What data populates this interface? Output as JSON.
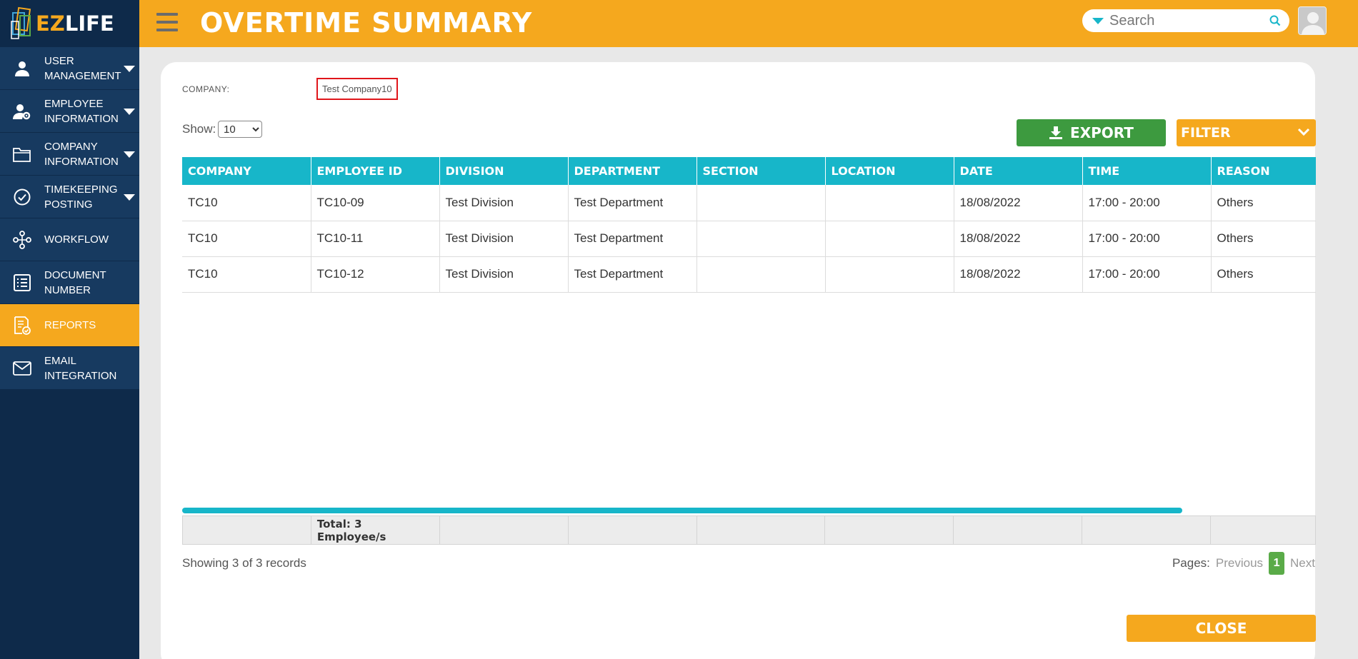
{
  "app": {
    "logo_ez": "EZ",
    "logo_life": "LIFE"
  },
  "sidebar": {
    "items": [
      {
        "line1": "USER",
        "line2": "MANAGEMENT",
        "icon": "user-icon",
        "caret": true
      },
      {
        "line1": "EMPLOYEE",
        "line2": "INFORMATION",
        "icon": "user-gear-icon",
        "caret": true
      },
      {
        "line1": "COMPANY",
        "line2": "INFORMATION",
        "icon": "folder-icon",
        "caret": true
      },
      {
        "line1": "TIMEKEEPING",
        "line2": "POSTING",
        "icon": "check-circle-icon",
        "caret": true
      },
      {
        "line1": "WORKFLOW",
        "line2": "",
        "icon": "workflow-icon",
        "caret": false
      },
      {
        "line1": "DOCUMENT",
        "line2": "NUMBER",
        "icon": "list-icon",
        "caret": false
      },
      {
        "line1": "REPORTS",
        "line2": "",
        "icon": "report-icon",
        "caret": false,
        "active": true
      },
      {
        "line1": "EMAIL",
        "line2": "INTEGRATION",
        "icon": "mail-icon",
        "caret": false
      }
    ]
  },
  "header": {
    "title": "OVERTIME SUMMARY",
    "search_placeholder": "Search"
  },
  "filters": {
    "company_label": "COMPANY:",
    "company_value": "Test Company10",
    "show_label": "Show:",
    "show_value": "10"
  },
  "actions": {
    "export_label": "EXPORT",
    "filter_label": "FILTER",
    "close_label": "CLOSE"
  },
  "table": {
    "columns": [
      "COMPANY",
      "EMPLOYEE ID",
      "DIVISION",
      "DEPARTMENT",
      "SECTION",
      "LOCATION",
      "DATE",
      "TIME",
      "REASON"
    ],
    "rows": [
      [
        "TC10",
        "TC10-09",
        "Test Division",
        "Test Department",
        "",
        "",
        "18/08/2022",
        "17:00 - 20:00",
        "Others"
      ],
      [
        "TC10",
        "TC10-11",
        "Test Division",
        "Test Department",
        "",
        "",
        "18/08/2022",
        "17:00 - 20:00",
        "Others"
      ],
      [
        "TC10",
        "TC10-12",
        "Test Division",
        "Test Department",
        "",
        "",
        "18/08/2022",
        "17:00 - 20:00",
        "Others"
      ]
    ],
    "footer_total": "Total: 3 Employee/s"
  },
  "pagination": {
    "records_text": "Showing 3 of 3 records",
    "pages_label": "Pages:",
    "previous": "Previous",
    "current": "1",
    "next": "Next"
  },
  "colors": {
    "accent": "#f5a81e",
    "sidebar": "#0e2a4a",
    "table_header": "#17b6c9",
    "export": "#3d9a3f"
  }
}
